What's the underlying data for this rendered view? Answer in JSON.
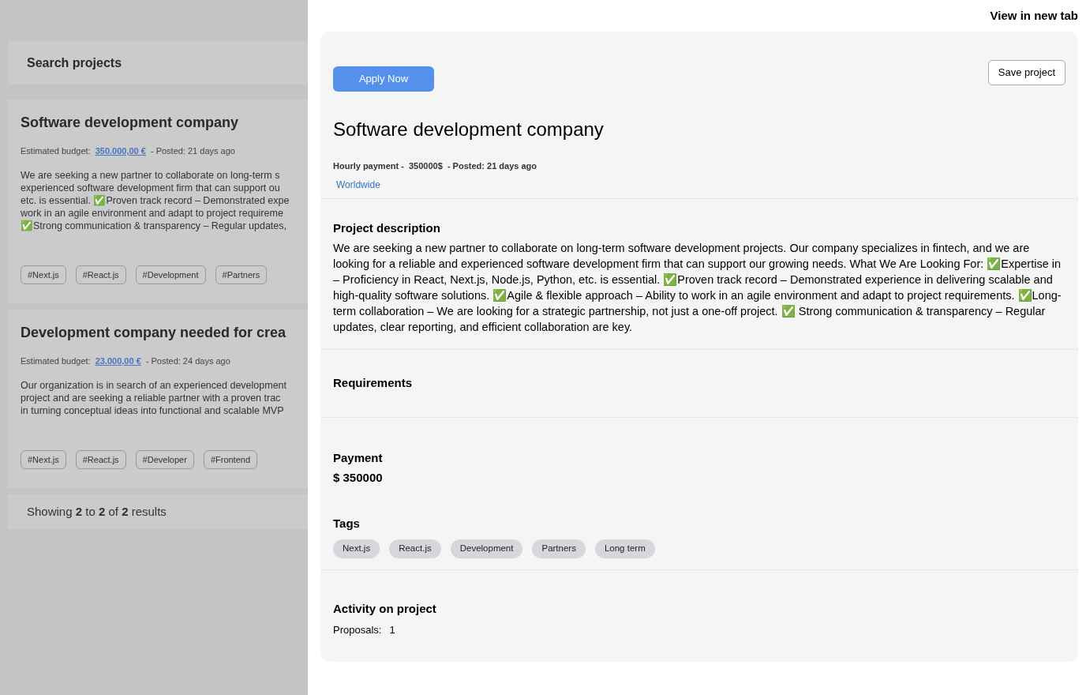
{
  "list_panel": {
    "search_title": "Search projects",
    "projects": [
      {
        "title": "Software development company",
        "budget_label": "Estimated budget:",
        "budget": "350.000,00 €",
        "posted": "- Posted: 21 days ago",
        "lines": [
          "We are seeking a new partner to collaborate on long-term s",
          "experienced software development firm that can support ou",
          "etc. is essential. ✅Proven track record – Demonstrated expe",
          "work in an agile environment and adapt to project requireme",
          "✅Strong communication & transparency – Regular updates,"
        ],
        "tags": [
          "#Next.js",
          "#React.js",
          "#Development",
          "#Partners"
        ]
      },
      {
        "title": "Development company needed for crea",
        "budget_label": "Estimated budget:",
        "budget": "23.000,00 €",
        "posted": "- Posted: 24 days ago",
        "lines": [
          "Our organization is in search of an experienced development",
          "project and are seeking a reliable partner with a proven trac",
          "in turning conceptual ideas into functional and scalable MVP"
        ],
        "tags": [
          "#Next.js",
          "#React.js",
          "#Developer",
          "#Frontend"
        ]
      }
    ],
    "results": "Showing **2** to **2** of **2** results"
  },
  "drawer": {
    "view_link": "View in new tab",
    "apply_button": "Apply Now",
    "save_button": "Save project",
    "title": "Software development company",
    "meta": "Hourly payment -  350000$  - Posted: 21 days ago",
    "location": "Worldwide",
    "description_heading": "Project description",
    "description": "We are seeking a new partner to collaborate on long-term software development projects. Our company specializes in fintech, and we are looking for a reliable and experienced software development firm that can support our growing needs. What We Are Looking For: ✅Expertise in – Proficiency in React, Next.js, Node.js, Python, etc. is essential. ✅Proven track record – Demonstrated experience in delivering scalable and high-quality software solutions. ✅Agile & flexible approach – Ability to work in an agile environment and adapt to project requirements. ✅Long-term collaboration – We are looking for a strategic partnership, not just a one-off project. ✅ Strong communication & transparency – Regular updates, clear reporting, and efficient collaboration are key.",
    "requirements_heading": "Requirements",
    "payment_heading": "Payment",
    "payment_value": "$ 350000",
    "tags_heading": "Tags",
    "tags": [
      "Next.js",
      "React.js",
      "Development",
      "Partners",
      "Long term"
    ],
    "activity_heading": "Activity on project",
    "proposals_label": "Proposals:",
    "proposals_value": "1"
  }
}
